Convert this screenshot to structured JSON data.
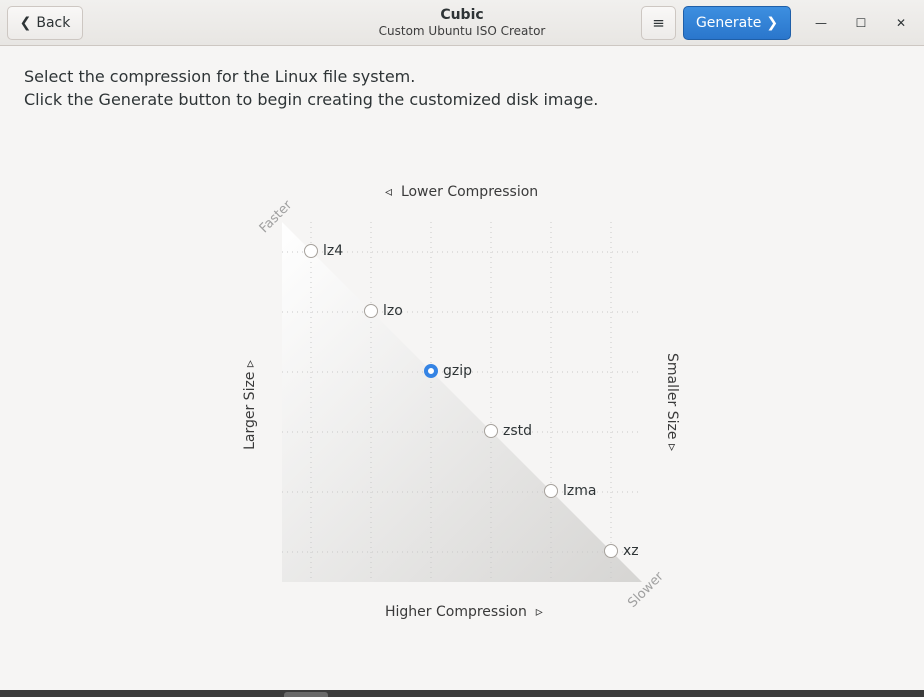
{
  "header": {
    "back_label": "Back",
    "back_icon": "chevron-left",
    "title": "Cubic",
    "subtitle": "Custom Ubuntu ISO Creator",
    "menu_icon": "hamburger-menu",
    "generate_label": "Generate",
    "generate_icon": "chevron-right",
    "accent_color": "#3584e4"
  },
  "instructions": {
    "line1": "Select the compression for the Linux file system.",
    "line2": "Click the Generate button to begin creating the customized disk image."
  },
  "chart": {
    "top_label": "Lower Compression",
    "bottom_label": "Higher Compression",
    "left_label": "Larger Size",
    "right_label": "Smaller Size",
    "top_left_label": "Faster",
    "bottom_right_label": "Slower",
    "options": [
      {
        "label": "lz4",
        "selected": false
      },
      {
        "label": "lzo",
        "selected": false
      },
      {
        "label": "gzip",
        "selected": true
      },
      {
        "label": "zstd",
        "selected": false
      },
      {
        "label": "lzma",
        "selected": false
      },
      {
        "label": "xz",
        "selected": false
      }
    ]
  }
}
